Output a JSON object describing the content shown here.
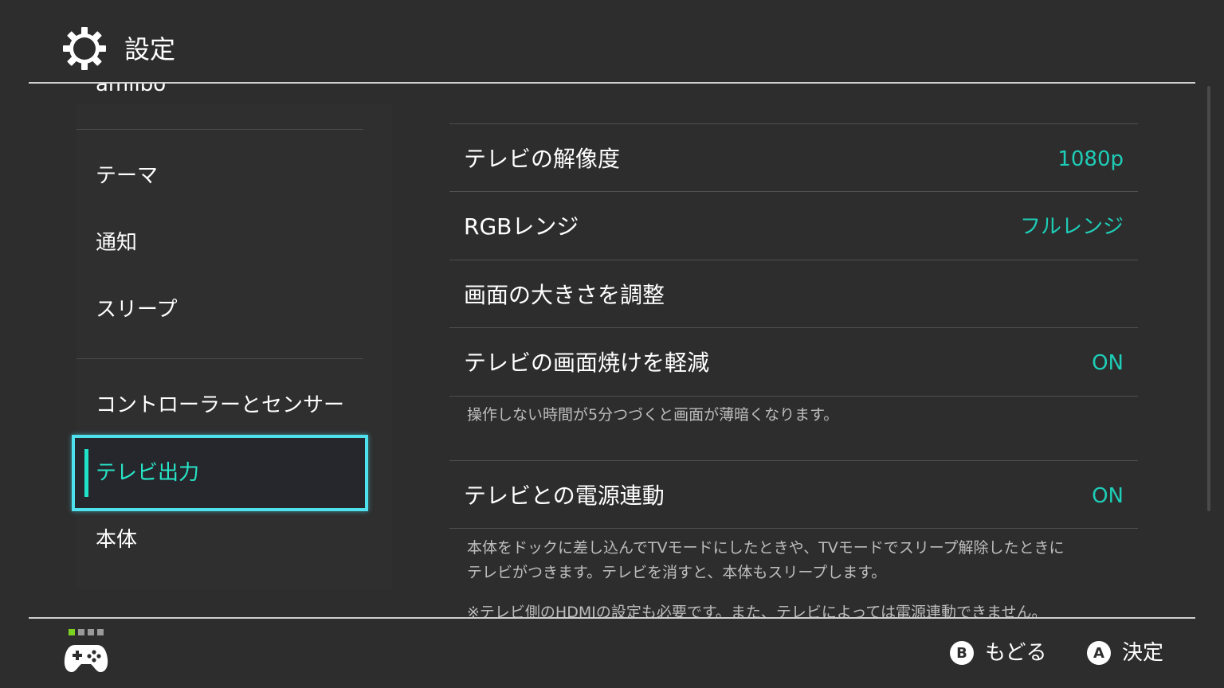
{
  "header": {
    "title": "設定",
    "icon": "gear-icon"
  },
  "sidebar": {
    "cut_item": "amiibo",
    "items": [
      {
        "label": "テーマ"
      },
      {
        "label": "通知"
      },
      {
        "label": "スリープ"
      },
      {
        "label": "コントローラーとセンサー"
      },
      {
        "label": "テレビ出力",
        "selected": true
      },
      {
        "label": "本体"
      }
    ]
  },
  "settings": {
    "resolution": {
      "label": "テレビの解像度",
      "value": "1080p"
    },
    "rgb_range": {
      "label": "RGBレンジ",
      "value": "フルレンジ"
    },
    "screen_size": {
      "label": "画面の大きさを調整"
    },
    "burn_in": {
      "label": "テレビの画面焼けを軽減",
      "value": "ON",
      "description": "操作しない時間が5分つづくと画面が薄暗くなります。"
    },
    "power_sync": {
      "label": "テレビとの電源連動",
      "value": "ON",
      "description_line1": "本体をドックに差し込んでTVモードにしたときや、TVモードでスリープ解除したときに",
      "description_line2": "テレビがつきます。テレビを消すと、本体もスリープします。",
      "note": "※テレビ側のHDMIの設定も必要です。また、テレビによっては電源連動できません。"
    }
  },
  "footer": {
    "back": {
      "button": "B",
      "label": "もどる"
    },
    "confirm": {
      "button": "A",
      "label": "決定"
    }
  },
  "colors": {
    "accent": "#1ecdb7",
    "selection_border": "#4ee0ec",
    "background": "#2d2d2d",
    "player_indicator": "#7bd321"
  }
}
